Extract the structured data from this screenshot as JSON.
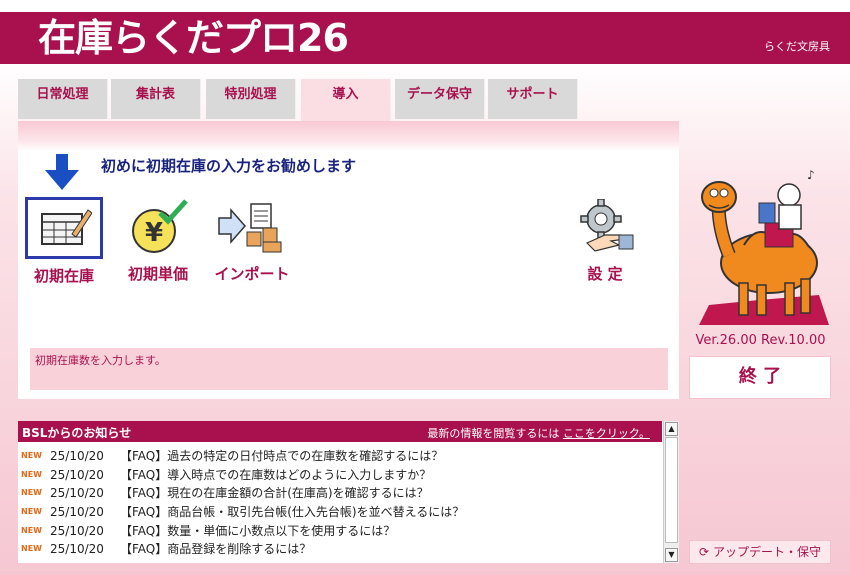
{
  "app": {
    "title": "在庫らくだプロ26",
    "company": "らくだ文房具"
  },
  "tabs": [
    {
      "label": "日常処理"
    },
    {
      "label": "集計表"
    },
    {
      "label": "特別処理"
    },
    {
      "label": "導入",
      "active": true
    },
    {
      "label": "データ保守"
    },
    {
      "label": "サポート"
    }
  ],
  "guide": {
    "text": "初めに初期在庫の入力をお勧めします"
  },
  "functions": [
    {
      "label": "初期在庫",
      "icon": "ledger-pen-icon",
      "selected": true
    },
    {
      "label": "初期単価",
      "icon": "yen-coin-check-icon"
    },
    {
      "label": "インポート",
      "icon": "import-boxes-icon"
    },
    {
      "label": "設 定",
      "icon": "gear-hand-icon"
    }
  ],
  "description": "初期在庫数を入力します。",
  "version": "Ver.26.00 Rev.10.00",
  "exit_label": "終 了",
  "news": {
    "title": "BSLからのお知らせ",
    "link_prefix": "最新の情報を閲覧するには ",
    "link_text": "ここをクリック。",
    "items": [
      {
        "badge": "NEW",
        "date": "25/10/20",
        "title": "【FAQ】過去の特定の日付時点での在庫数を確認するには？"
      },
      {
        "badge": "NEW",
        "date": "25/10/20",
        "title": "【FAQ】導入時点での在庫数はどのように入力しますか？"
      },
      {
        "badge": "NEW",
        "date": "25/10/20",
        "title": "【FAQ】現在の在庫金額の合計(在庫高)を確認するには？"
      },
      {
        "badge": "NEW",
        "date": "25/10/20",
        "title": "【FAQ】商品台帳・取引先台帳(仕入先台帳)を並べ替えるには？"
      },
      {
        "badge": "NEW",
        "date": "25/10/20",
        "title": "【FAQ】数量・単価に小数点以下を使用するには？"
      },
      {
        "badge": "NEW",
        "date": "25/10/20",
        "title": "【FAQ】商品登録を削除するには？"
      }
    ]
  },
  "update_label": "アップデート・保守",
  "colors": {
    "brand": "#a8114e",
    "tab_inactive": "#d9d9d9",
    "accent_blue": "#1a4fc4"
  }
}
